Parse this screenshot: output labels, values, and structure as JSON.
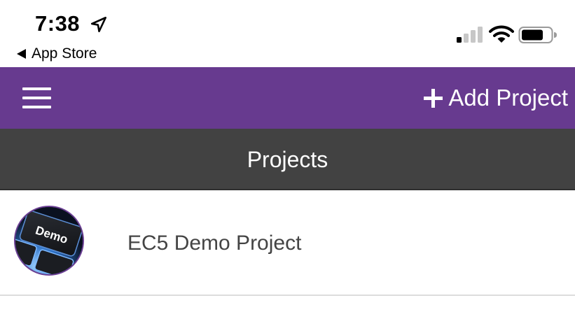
{
  "status_bar": {
    "time": "7:38",
    "back_app_label": "App Store",
    "icons": [
      "location-arrow-icon",
      "cellular-signal-icon",
      "wifi-icon",
      "battery-icon"
    ]
  },
  "toolbar": {
    "background_color": "#673a8f",
    "menu_icon": "hamburger-menu-icon",
    "add_project_label": "Add Project",
    "add_icon": "plus-icon"
  },
  "section_header": {
    "title": "Projects",
    "background_color": "#424242"
  },
  "projects": [
    {
      "name": "EC5 Demo Project",
      "avatar_text": "Demo",
      "avatar_icon": "keyboard-key-demo-logo"
    }
  ]
}
